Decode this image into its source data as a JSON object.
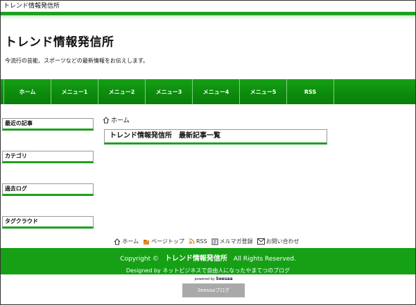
{
  "topbar": {
    "text": "トレンド情報発信所"
  },
  "header": {
    "site_title": "トレンド情報発信所",
    "tagline": "今流行の芸能、スポーツなどの最新情報をお伝えします。"
  },
  "nav": {
    "items": [
      "ホーム",
      "メニュー1",
      "メニュー2",
      "メニュー3",
      "メニュー4",
      "メニュー5",
      "RSS"
    ]
  },
  "sidebar": {
    "boxes": [
      "最近の記事",
      "カテゴリ",
      "過去ログ",
      "タグクラウド"
    ]
  },
  "main": {
    "breadcrumb": "ホーム",
    "heading": "トレンド情報発信所　最新記事一覧"
  },
  "footer_links": {
    "home": "ホーム",
    "pagetop": "ページトップ",
    "rss": "RSS",
    "mailmag": "メルマガ登録",
    "contact": "お問い合わせ"
  },
  "footer": {
    "copyright_prefix": "Copyright ©",
    "site_name": "トレンド情報発信所",
    "rights": "All Rights Reserved.",
    "designed": "Designed by ネットビジネスで自由人になったやまてつのブログ"
  },
  "powered": {
    "label": "powered by",
    "brand": "Seesaa"
  },
  "seesaa_button": {
    "label": "Seesaaブログ"
  },
  "colors": {
    "accent_green": "#1ea01e",
    "nav_green": "#0c8c0c",
    "button_gray": "#a9a9a9"
  }
}
